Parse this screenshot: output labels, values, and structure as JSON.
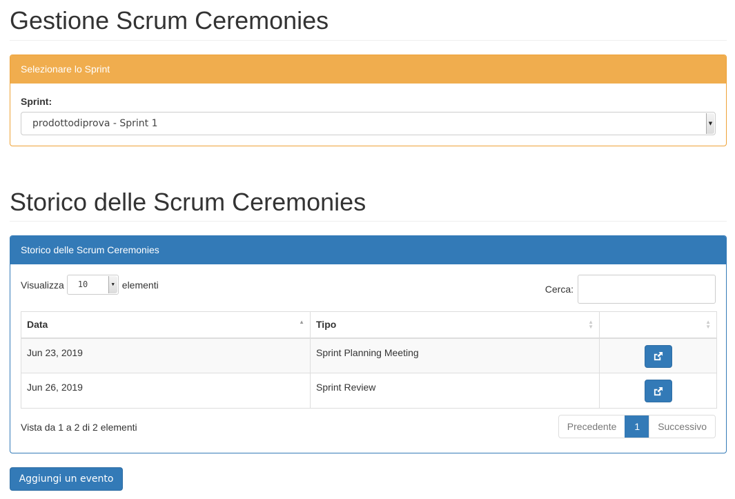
{
  "page": {
    "title": "Gestione Scrum Ceremonies",
    "history_title": "Storico delle Scrum Ceremonies"
  },
  "sprint_panel": {
    "heading": "Selezionare lo Sprint",
    "label": "Sprint:",
    "selected": "prodottodiprova - Sprint 1"
  },
  "history_panel": {
    "heading": "Storico delle Scrum Ceremonies",
    "length_prefix": "Visualizza",
    "length_value": "10",
    "length_suffix": "elementi",
    "search_label": "Cerca:",
    "search_value": "",
    "columns": [
      "Data",
      "Tipo",
      ""
    ],
    "rows": [
      {
        "data": "Jun 23, 2019",
        "tipo": "Sprint Planning Meeting"
      },
      {
        "data": "Jun 26, 2019",
        "tipo": "Sprint Review"
      }
    ],
    "info": "Vista da 1 a 2 di 2 elementi",
    "pagination": {
      "previous": "Precedente",
      "current": "1",
      "next": "Successivo"
    }
  },
  "actions": {
    "add_event": "Aggiungi un evento"
  },
  "colors": {
    "warning": "#f0ad4e",
    "primary": "#337ab7"
  },
  "icons": {
    "open": "external-link-icon",
    "sort": "sort-icon",
    "dropdown": "caret-down-icon"
  }
}
